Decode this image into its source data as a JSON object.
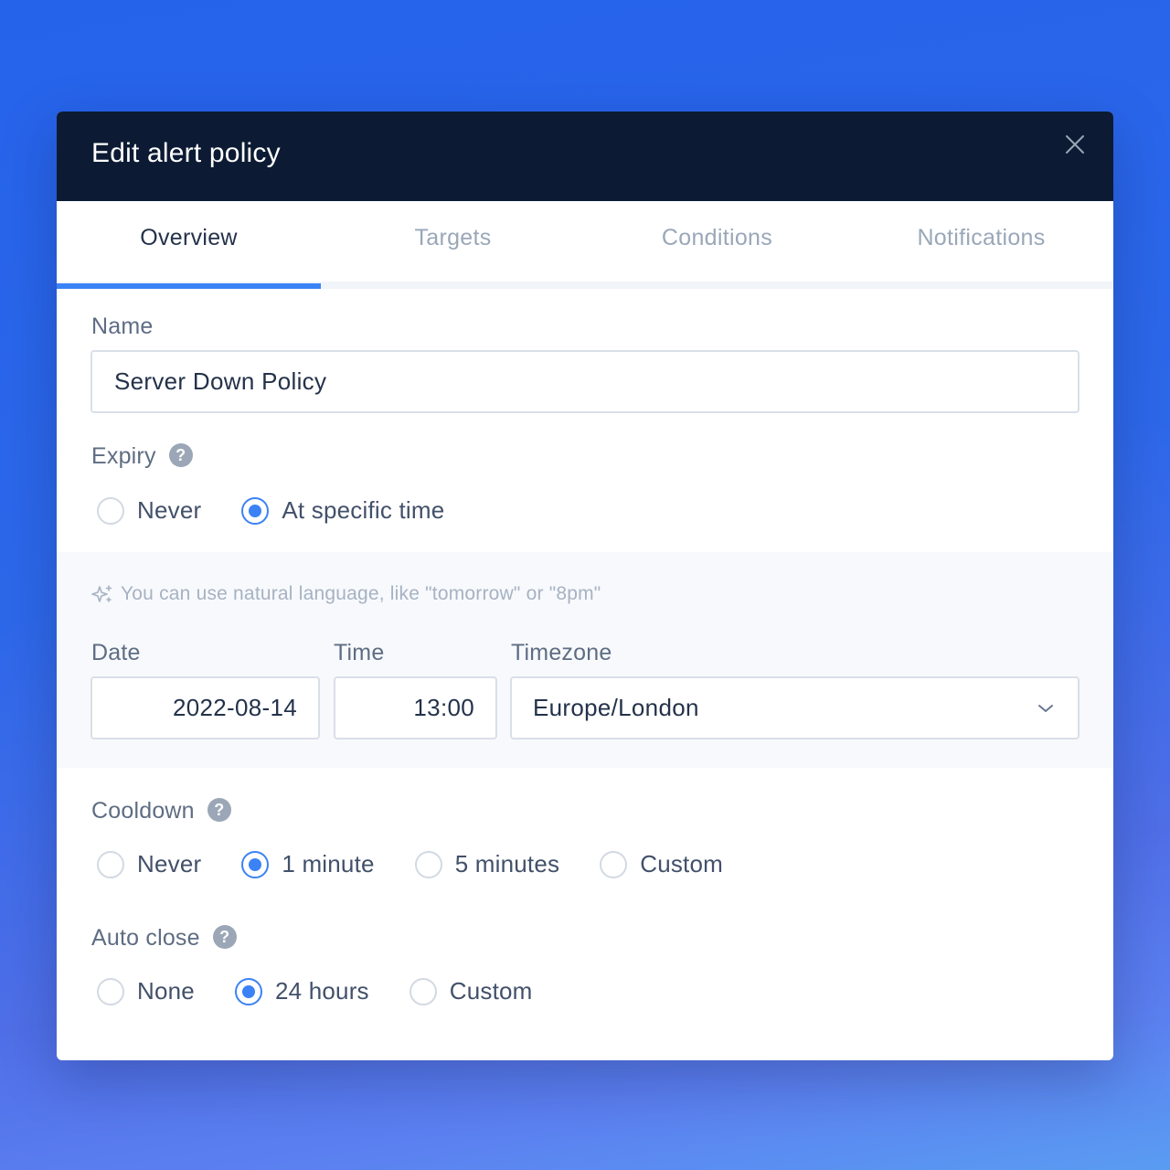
{
  "dialog": {
    "title": "Edit alert policy"
  },
  "tabs": [
    {
      "label": "Overview",
      "active": true
    },
    {
      "label": "Targets",
      "active": false
    },
    {
      "label": "Conditions",
      "active": false
    },
    {
      "label": "Notifications",
      "active": false
    }
  ],
  "name": {
    "label": "Name",
    "value": "Server Down Policy"
  },
  "expiry": {
    "label": "Expiry",
    "options": [
      "Never",
      "At specific time"
    ],
    "selected": "At specific time",
    "hint": "You can use natural language, like \"tomorrow\" or \"8pm\"",
    "date_label": "Date",
    "date_value": "2022-08-14",
    "time_label": "Time",
    "time_value": "13:00",
    "timezone_label": "Timezone",
    "timezone_value": "Europe/London"
  },
  "cooldown": {
    "label": "Cooldown",
    "options": [
      "Never",
      "1 minute",
      "5 minutes",
      "Custom"
    ],
    "selected": "1 minute"
  },
  "auto_close": {
    "label": "Auto close",
    "options": [
      "None",
      "24 hours",
      "Custom"
    ],
    "selected": "24 hours"
  },
  "colors": {
    "header_bg": "#0c1b33",
    "accent": "#3b82f6",
    "background_gradient_top": "#2563eb",
    "background_gradient_bottom": "#5a9cf2"
  },
  "icons": {
    "close": "close-icon",
    "help": "help-icon",
    "hint": "sparkle-icon",
    "dropdown": "chevron-down-icon"
  }
}
